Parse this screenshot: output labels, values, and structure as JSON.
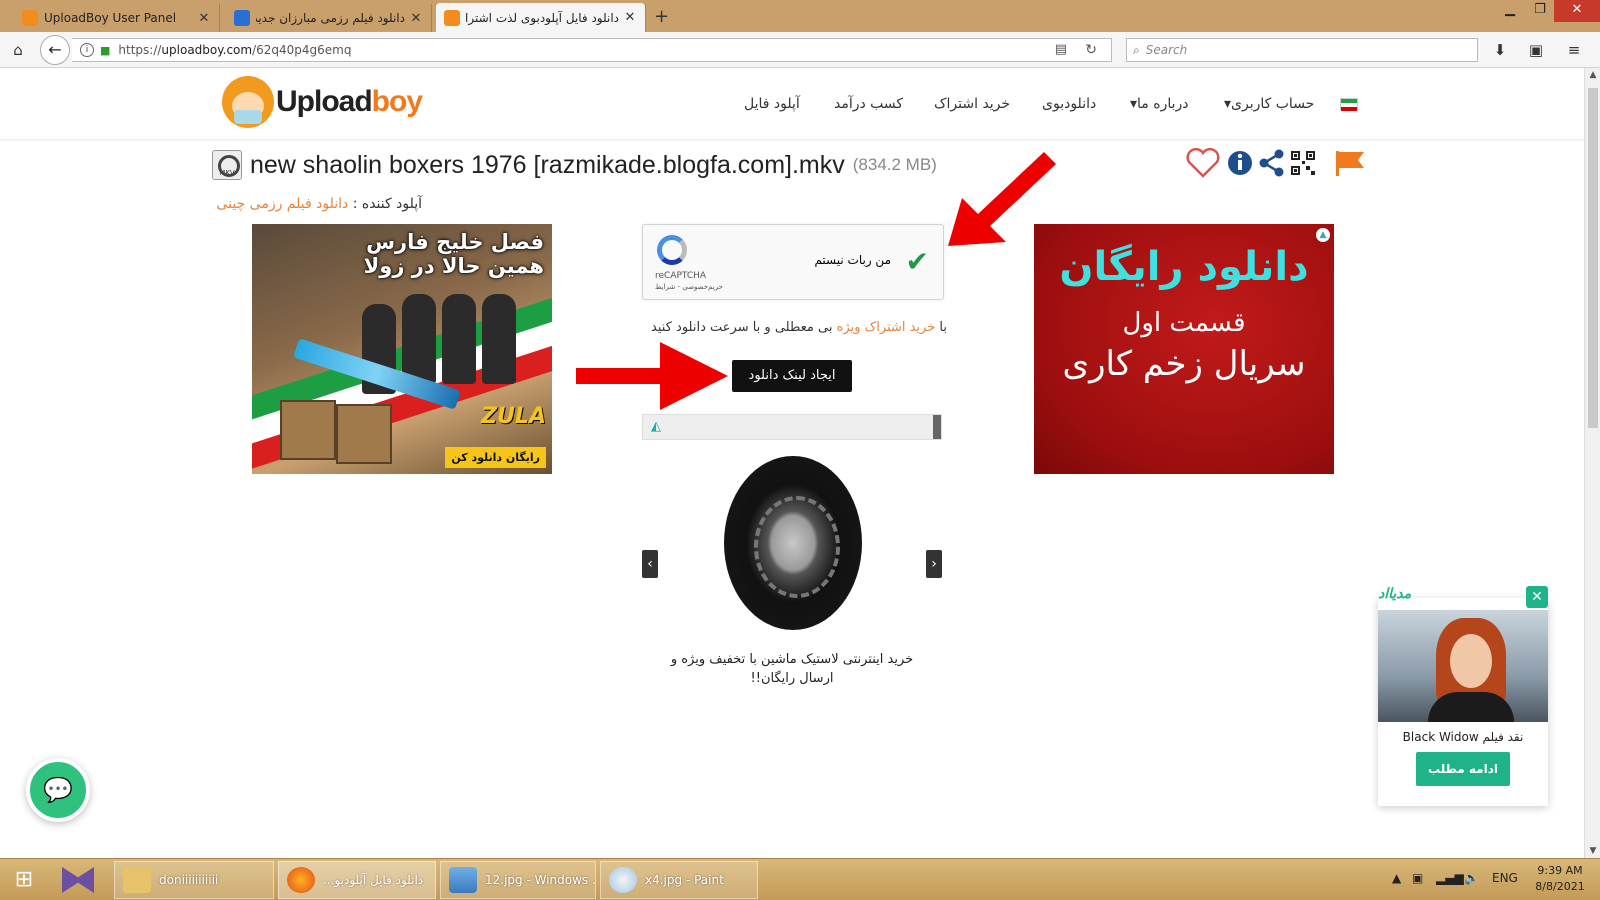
{
  "browser": {
    "tabs": [
      {
        "label": "UploadBoy User Panel",
        "favicon_color": "#f28c1d"
      },
      {
        "label": "دانلود فیلم رزمی مبارزان جدید",
        "favicon_color": "#2a6fd6"
      },
      {
        "label": "دانلود فایل آپلودبوی لذت اشترا",
        "favicon_color": "#f28c1d",
        "active": true
      }
    ],
    "url": {
      "prefix": "https://",
      "domain": "uploadboy.com",
      "path": "/62q40p4g6emq"
    },
    "search_placeholder": "Search"
  },
  "site": {
    "logo": {
      "part1": "Upload",
      "part2": "boy"
    },
    "menu": [
      {
        "label": "حساب کاربری",
        "dropdown": true
      },
      {
        "label": "درباره ما",
        "dropdown": true
      },
      {
        "label": "دانلودبوی"
      },
      {
        "label": "خرید اشتراک"
      },
      {
        "label": "کسب درآمد"
      },
      {
        "label": "آپلود فایل"
      }
    ],
    "flag_colors": [
      "#239f40",
      "#ffffff",
      "#da0000"
    ]
  },
  "file": {
    "icon_label": "MKV",
    "name": "new shaolin boxers 1976 [razmikade.blogfa.com].mkv",
    "size": "(834.2 MB)",
    "uploader_label": "آپلود کننده :",
    "uploader_name": "دانلود فیلم رزمی چینی"
  },
  "actions": {
    "icons": [
      "heart-icon",
      "info-icon",
      "share-icon",
      "qr-code-icon",
      "report-flag-icon"
    ]
  },
  "recaptcha": {
    "label": "من ربات نیستم",
    "brand": "reCAPTCHA",
    "terms": "حریم‌خصوصی - شرایط"
  },
  "download": {
    "vip_prefix": "با",
    "vip_link": "خرید اشتراک ویژه",
    "vip_suffix": "بی معطلی و با سرعت دانلود کنید",
    "button": "ایجاد لینک دانلود"
  },
  "carousel": {
    "caption": "خرید اینترنتی لاستیک ماشین با تخفیف ویژه و ارسال رایگان!!"
  },
  "ad_left": {
    "line1": "فصل خلیج فارس",
    "line2": "همین حالا در زولا",
    "brand": "ZULA",
    "cta": "رایگان دانلود کن"
  },
  "ad_right": {
    "line1": "دانلود رایگان",
    "line2": "قسمت اول",
    "line3": "سریال زخم کاری"
  },
  "popup_ad": {
    "brand": "مدیااد",
    "title": "نقد فیلم Black Widow",
    "button": "ادامه مطلب"
  },
  "taskbar": {
    "tasks": [
      {
        "label": "doniiiiiiiiiii"
      },
      {
        "label": "دانلود فایل آپلودبو...",
        "active": true
      },
      {
        "label": "12.jpg - Windows ..."
      },
      {
        "label": "x4.jpg - Paint"
      }
    ],
    "language": "ENG",
    "time": "9:39 AM",
    "date": "8/8/2021"
  }
}
